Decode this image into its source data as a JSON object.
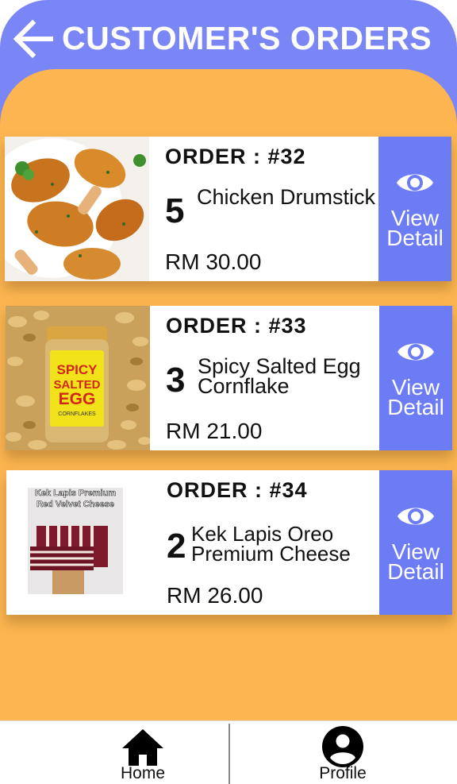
{
  "header": {
    "title": "CUSTOMER'S ORDERS",
    "back_icon": "arrow-left-icon"
  },
  "colors": {
    "header_bg": "#7b86f6",
    "content_bg": "#fcb551",
    "view_button_bg": "#6b7cf5"
  },
  "orders": [
    {
      "order_label": "ORDER : #32",
      "quantity": "5",
      "item_name": "Chicken Drumstick",
      "price": "RM 30.00",
      "view_label": "View Detail"
    },
    {
      "order_label": "ORDER : #33",
      "quantity": "3",
      "item_name": "Spicy Salted Egg Cornflake",
      "price": "RM 21.00",
      "view_label": "View Detail",
      "product_image_text": [
        "SPICY",
        "SALTED",
        "EGG",
        "CORNFLAKES"
      ]
    },
    {
      "order_label": "ORDER : #34",
      "quantity": "2",
      "item_name": "Kek Lapis Oreo Premium Cheese",
      "price": "RM 26.00",
      "view_label": "View Detail",
      "product_image_text": [
        "Kek Lapis Premium",
        "Red Velvet Cheese"
      ]
    }
  ],
  "bottom_nav": {
    "home_label": "Home",
    "profile_label": "Profile"
  }
}
